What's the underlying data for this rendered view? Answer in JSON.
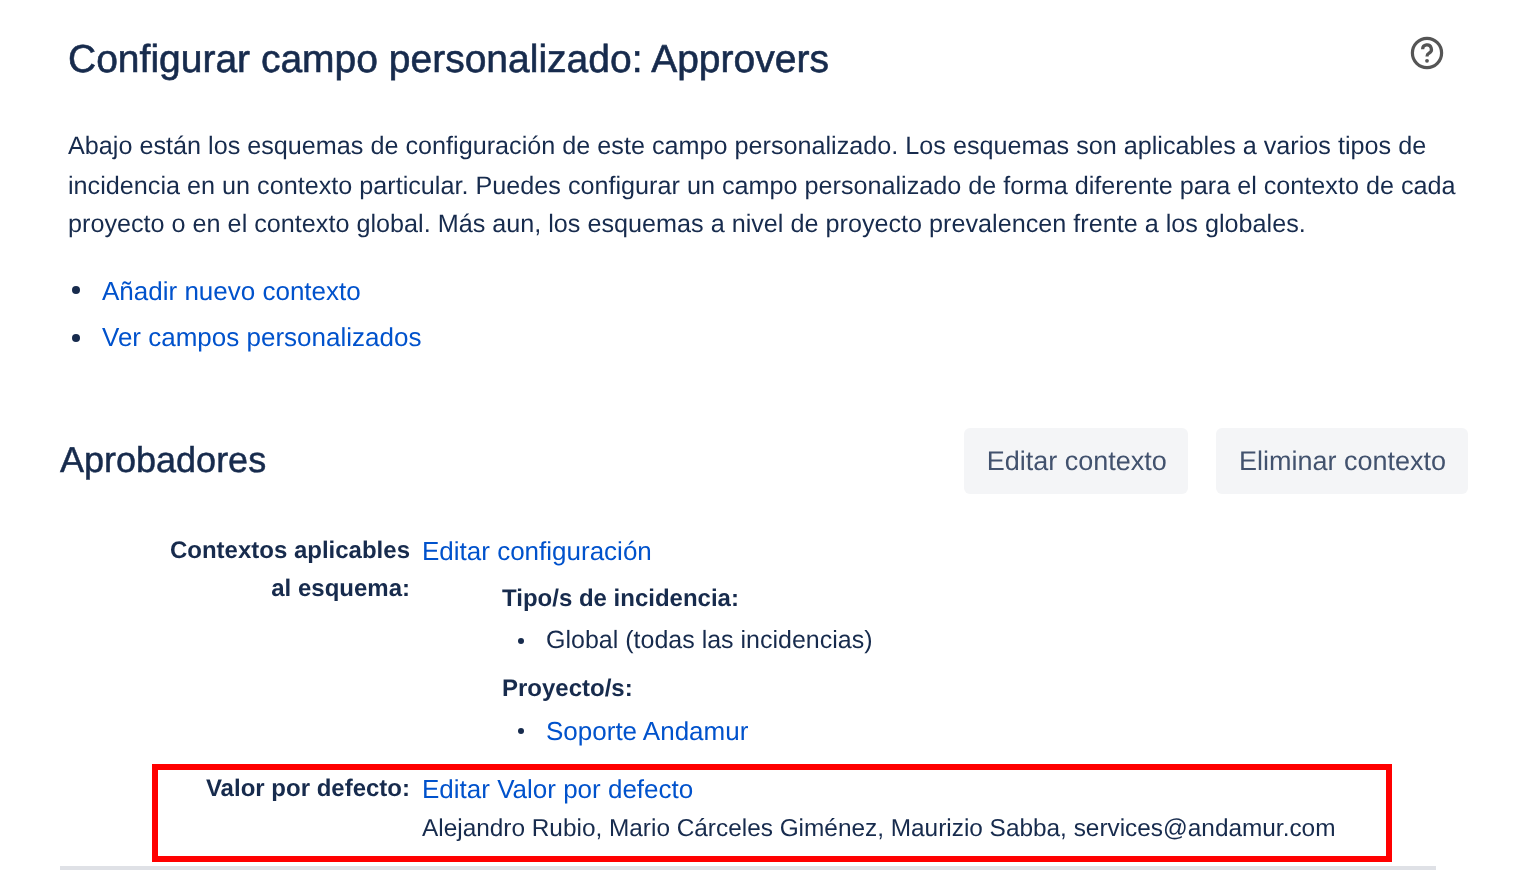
{
  "page": {
    "title": "Configurar campo personalizado: Approvers",
    "description": "Abajo están los esquemas de configuración de este campo personalizado. Los esquemas son aplicables a varios tipos de incidencia en un contexto particular. Puedes configurar un campo personalizado de forma diferente para el contexto de cada proyecto o en el contexto global. Más aun, los esquemas a nivel de proyecto prevalencen frente a los globales.",
    "links": [
      "Añadir nuevo contexto",
      "Ver campos personalizados"
    ]
  },
  "scheme": {
    "name": "Aprobadores",
    "buttons": [
      "Editar contexto",
      "Eliminar contexto"
    ],
    "rows": [
      {
        "label": "Contextos aplicables al esquema:",
        "link": "Editar configuración",
        "highlighted": false,
        "groups": [
          {
            "heading": "Tipo/s de incidencia:",
            "items": [
              {
                "text": "Global (todas las incidencias)",
                "kind": "text"
              }
            ]
          },
          {
            "heading": "Proyecto/s:",
            "items": [
              {
                "text": "Soporte Andamur",
                "kind": "link"
              }
            ]
          }
        ]
      },
      {
        "label": "Valor por defecto:",
        "link": "Editar Valor por defecto",
        "highlighted": true,
        "value": "Alejandro Rubio, Mario Cárceles Giménez, Maurizio Sabba, services@andamur.com"
      }
    ]
  }
}
